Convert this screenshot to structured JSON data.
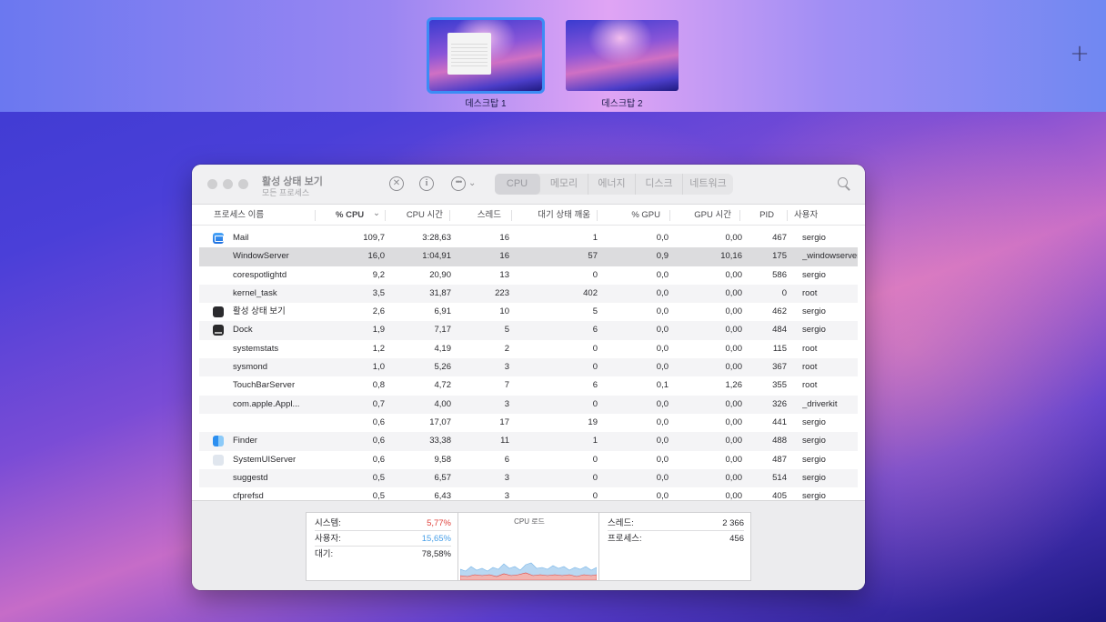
{
  "spaces": {
    "items": [
      {
        "label": "데스크탑 1"
      },
      {
        "label": "데스크탑 2"
      }
    ],
    "add_label": "+"
  },
  "window": {
    "title": "활성 상태 보기",
    "subtitle": "모든 프로세스",
    "toolbar": {
      "stop_icon": "✕",
      "info_icon": "i",
      "more_icon": "•••",
      "chevron": "⌄"
    },
    "tabs": [
      {
        "label": "CPU",
        "active": true
      },
      {
        "label": "메모리"
      },
      {
        "label": "에너지"
      },
      {
        "label": "디스크"
      },
      {
        "label": "네트워크"
      }
    ],
    "columns": {
      "name": "프로세스 이름",
      "cpu": "% CPU",
      "cpu_time": "CPU 시간",
      "threads": "스레드",
      "idle_wake": "대기 상태 깨움",
      "gpu": "% GPU",
      "gpu_time": "GPU 시간",
      "pid": "PID",
      "user": "사용자",
      "sort_indicator": "⌄"
    },
    "rows": [
      {
        "icon": "mail-icon",
        "name": "Mail",
        "cpu": "109,7",
        "cpu_time": "3:28,63",
        "threads": "16",
        "idle_wake": "1",
        "gpu": "0,0",
        "gpu_time": "0,00",
        "pid": "467",
        "user": "sergio"
      },
      {
        "icon": "",
        "name": "WindowServer",
        "cpu": "16,0",
        "cpu_time": "1:04,91",
        "threads": "16",
        "idle_wake": "57",
        "gpu": "0,9",
        "gpu_time": "10,16",
        "pid": "175",
        "user": "_windowserver"
      },
      {
        "icon": "",
        "name": "corespotlightd",
        "cpu": "9,2",
        "cpu_time": "20,90",
        "threads": "13",
        "idle_wake": "0",
        "gpu": "0,0",
        "gpu_time": "0,00",
        "pid": "586",
        "user": "sergio"
      },
      {
        "icon": "",
        "name": "kernel_task",
        "cpu": "3,5",
        "cpu_time": "31,87",
        "threads": "223",
        "idle_wake": "402",
        "gpu": "0,0",
        "gpu_time": "0,00",
        "pid": "0",
        "user": "root"
      },
      {
        "icon": "activity-monitor-icon",
        "name": "활성 상태 보기",
        "cpu": "2,6",
        "cpu_time": "6,91",
        "threads": "10",
        "idle_wake": "5",
        "gpu": "0,0",
        "gpu_time": "0,00",
        "pid": "462",
        "user": "sergio"
      },
      {
        "icon": "dock-icon",
        "name": "Dock",
        "cpu": "1,9",
        "cpu_time": "7,17",
        "threads": "5",
        "idle_wake": "6",
        "gpu": "0,0",
        "gpu_time": "0,00",
        "pid": "484",
        "user": "sergio"
      },
      {
        "icon": "",
        "name": "systemstats",
        "cpu": "1,2",
        "cpu_time": "4,19",
        "threads": "2",
        "idle_wake": "0",
        "gpu": "0,0",
        "gpu_time": "0,00",
        "pid": "115",
        "user": "root"
      },
      {
        "icon": "",
        "name": "sysmond",
        "cpu": "1,0",
        "cpu_time": "5,26",
        "threads": "3",
        "idle_wake": "0",
        "gpu": "0,0",
        "gpu_time": "0,00",
        "pid": "367",
        "user": "root"
      },
      {
        "icon": "",
        "name": "TouchBarServer",
        "cpu": "0,8",
        "cpu_time": "4,72",
        "threads": "7",
        "idle_wake": "6",
        "gpu": "0,1",
        "gpu_time": "1,26",
        "pid": "355",
        "user": "root"
      },
      {
        "icon": "",
        "name": "com.apple.Appl...",
        "cpu": "0,7",
        "cpu_time": "4,00",
        "threads": "3",
        "idle_wake": "0",
        "gpu": "0,0",
        "gpu_time": "0,00",
        "pid": "326",
        "user": "_driverkit"
      },
      {
        "icon": "",
        "name": "",
        "cpu": "0,6",
        "cpu_time": "17,07",
        "threads": "17",
        "idle_wake": "19",
        "gpu": "0,0",
        "gpu_time": "0,00",
        "pid": "441",
        "user": "sergio"
      },
      {
        "icon": "finder-icon",
        "name": "Finder",
        "cpu": "0,6",
        "cpu_time": "33,38",
        "threads": "11",
        "idle_wake": "1",
        "gpu": "0,0",
        "gpu_time": "0,00",
        "pid": "488",
        "user": "sergio"
      },
      {
        "icon": "systemuiserver-icon",
        "name": "SystemUIServer",
        "cpu": "0,6",
        "cpu_time": "9,58",
        "threads": "6",
        "idle_wake": "0",
        "gpu": "0,0",
        "gpu_time": "0,00",
        "pid": "487",
        "user": "sergio"
      },
      {
        "icon": "",
        "name": "suggestd",
        "cpu": "0,5",
        "cpu_time": "6,57",
        "threads": "3",
        "idle_wake": "0",
        "gpu": "0,0",
        "gpu_time": "0,00",
        "pid": "514",
        "user": "sergio"
      },
      {
        "icon": "",
        "name": "cfprefsd",
        "cpu": "0,5",
        "cpu_time": "6,43",
        "threads": "3",
        "idle_wake": "0",
        "gpu": "0,0",
        "gpu_time": "0,00",
        "pid": "405",
        "user": "sergio"
      }
    ],
    "selected_row": 1,
    "footer": {
      "system_label": "시스템:",
      "system_value": "5,77%",
      "user_label": "사용자:",
      "user_value": "15,65%",
      "idle_label": "대기:",
      "idle_value": "78,58%",
      "cpu_load_title": "CPU 로드",
      "threads_label": "스레드:",
      "threads_value": "2 366",
      "processes_label": "프로세스:",
      "processes_value": "456"
    }
  },
  "colors": {
    "selection_ring": "#3c8cf5",
    "system_load": "#e0443e",
    "user_load": "#4aa0e8"
  }
}
